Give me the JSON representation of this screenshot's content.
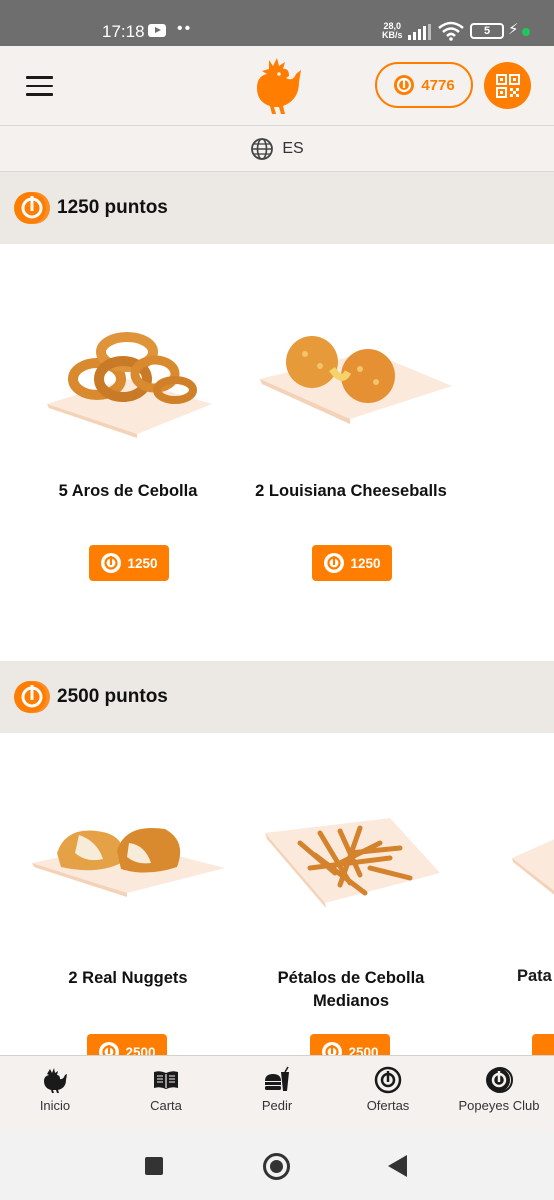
{
  "status_bar": {
    "time": "17:18",
    "net_speed_value": "28,0",
    "net_speed_unit": "KB/s",
    "battery_level": "5"
  },
  "header": {
    "menu_icon": "hamburger-menu-icon",
    "logo": "popeyes-rooster-logo",
    "points_value": "4776",
    "qr_icon": "qr-code-icon"
  },
  "language": {
    "code": "ES",
    "icon": "globe-icon"
  },
  "colors": {
    "brand_orange": "#ff7d00",
    "header_bg": "#f4f1ee",
    "section_bg": "#ece8e4"
  },
  "sections": [
    {
      "title": "1250 puntos",
      "items": [
        {
          "name": "5 Aros de Cebolla",
          "price": "1250"
        },
        {
          "name": "2 Louisiana Cheeseballs",
          "price": "1250"
        }
      ]
    },
    {
      "title": "2500 puntos",
      "items": [
        {
          "name": "2 Real Nuggets",
          "price": "2500"
        },
        {
          "name": "Pétalos de Cebolla Medianos",
          "price": "2500"
        },
        {
          "name": "Pata",
          "price": ""
        }
      ]
    }
  ],
  "bottom_nav": [
    {
      "label": "Inicio",
      "icon": "rooster-icon"
    },
    {
      "label": "Carta",
      "icon": "open-book-icon"
    },
    {
      "label": "Pedir",
      "icon": "burger-drink-icon"
    },
    {
      "label": "Ofertas",
      "icon": "offers-coin-icon"
    },
    {
      "label": "Popeyes Club",
      "icon": "club-coin-icon"
    }
  ]
}
